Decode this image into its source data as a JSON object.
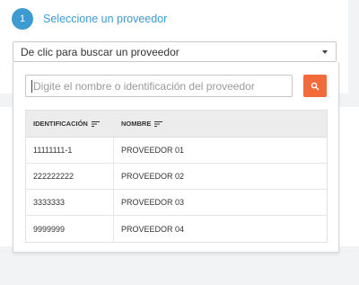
{
  "step": {
    "number": "1",
    "label": "Seleccione un proveedor"
  },
  "provider_select": {
    "value": "De clic para buscar un proveedor"
  },
  "search": {
    "placeholder": "Digite el nombre o identificación del proveedor"
  },
  "table": {
    "headers": [
      "IDENTIFICACIÓN",
      "NOMBRE"
    ],
    "rows": [
      [
        "11111111-1",
        "PROVEEDOR 01"
      ],
      [
        "222222222",
        "PROVEEDOR 02"
      ],
      [
        "3333333",
        "PROVEEDOR 03"
      ],
      [
        "9999999",
        "PROVEEDOR 04"
      ]
    ]
  },
  "colors": {
    "accent": "#3d9bd2",
    "search_button": "#f26b3a"
  }
}
